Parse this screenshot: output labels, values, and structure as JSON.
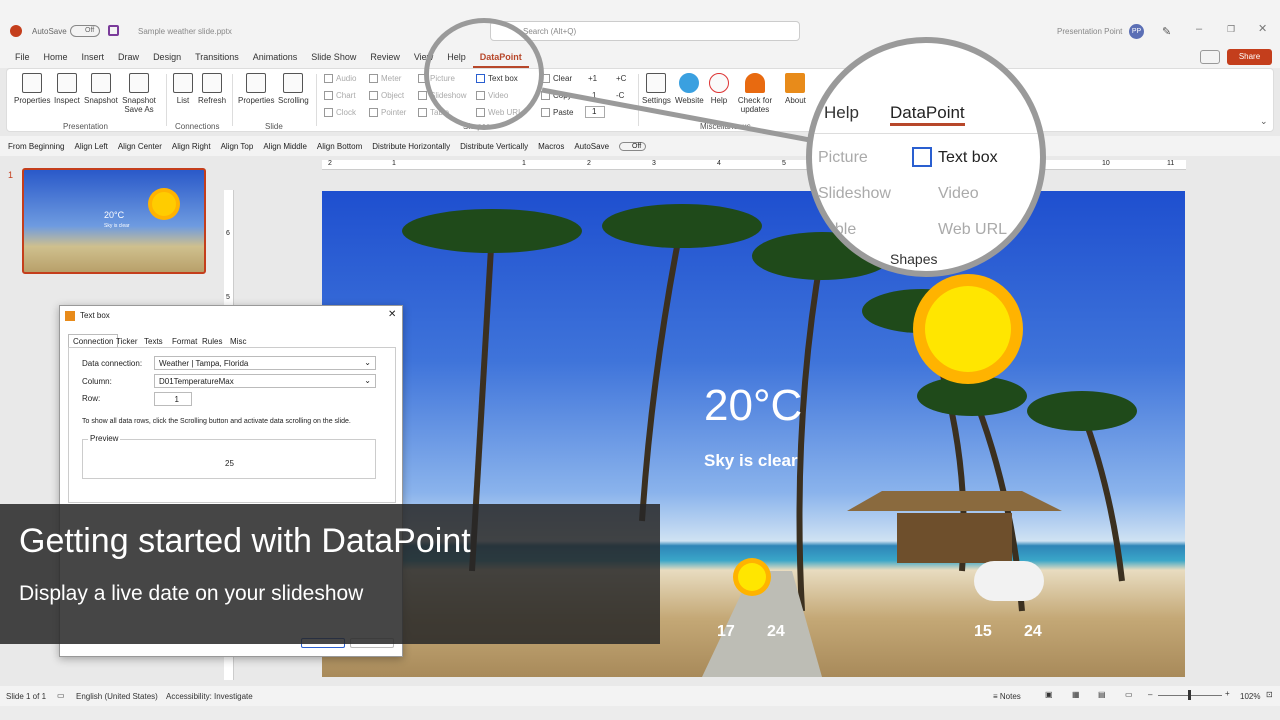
{
  "titlebar": {
    "autosave_label": "AutoSave",
    "autosave_state": "Off",
    "filename": "Sample weather slide.pptx",
    "search_placeholder": "Search (Alt+Q)",
    "user_name": "Presentation Point",
    "user_initials": "PP"
  },
  "menu_tabs": [
    "File",
    "Home",
    "Insert",
    "Draw",
    "Design",
    "Transitions",
    "Animations",
    "Slide Show",
    "Review",
    "View",
    "Help",
    "DataPoint"
  ],
  "active_tab": "DataPoint",
  "share_label": "Share",
  "ribbon": {
    "presentation": {
      "buttons": [
        "Properties",
        "Inspect",
        "Snapshot",
        "Snapshot Save As"
      ],
      "group": "Presentation"
    },
    "connections": {
      "buttons": [
        "List",
        "Refresh"
      ],
      "group": "Connections"
    },
    "slide": {
      "buttons": [
        "Properties",
        "Scrolling"
      ],
      "group": "Slide"
    },
    "shapes_col1": [
      "Audio",
      "Chart",
      "Clock"
    ],
    "shapes_col2": [
      "Meter",
      "Object",
      "Pointer"
    ],
    "shapes_col3": [
      "Picture",
      "Slideshow",
      "Table"
    ],
    "shapes_col4": [
      "Text box",
      "Video",
      "Web URL"
    ],
    "shapes_group": "Shapes",
    "clipboard": [
      "Clear",
      "Copy",
      "Paste"
    ],
    "counter": [
      "+1",
      "-1",
      "+C",
      "-C"
    ],
    "counter_value": "1",
    "misc": {
      "buttons": [
        "Settings",
        "Website",
        "Help",
        "Check for updates"
      ],
      "group": "Miscellaneous"
    },
    "about": "About"
  },
  "quick_toolbar": [
    "From Beginning",
    "Align Left",
    "Align Center",
    "Align Right",
    "Align Top",
    "Align Middle",
    "Align Bottom",
    "Distribute Horizontally",
    "Distribute Vertically",
    "Macros"
  ],
  "qt_autosave": "AutoSave",
  "qt_autosave_state": "Off",
  "slide_number": "1",
  "ruler_marks": [
    "2",
    "1",
    "1",
    "2",
    "3",
    "4",
    "5",
    "6",
    "7",
    "8",
    "9",
    "10",
    "11"
  ],
  "ruler_left_marks": [
    "6",
    "5"
  ],
  "magnifier": {
    "tabs": [
      "Help",
      "DataPoint"
    ],
    "col1": [
      "Picture",
      "Slideshow",
      "Table"
    ],
    "col2": [
      "Text box",
      "Video",
      "Web URL"
    ],
    "group": "Shapes"
  },
  "slide": {
    "temperature": "20°C",
    "condition": "Sky is clear",
    "day1_low": "17",
    "day1_high": "24",
    "day2_low": "15",
    "day2_high": "24"
  },
  "dialog": {
    "title": "Text box",
    "tabs": [
      "Connection",
      "Ticker",
      "Texts",
      "Format",
      "Rules",
      "Misc"
    ],
    "data_connection_label": "Data connection:",
    "data_connection_value": "Weather | Tampa, Florida",
    "column_label": "Column:",
    "column_value": "D01TemperatureMax",
    "row_label": "Row:",
    "row_value": "1",
    "hint": "To show all data rows, click the Scrolling button and activate data scrolling on the slide.",
    "preview_label": "Preview",
    "preview_value": "25"
  },
  "overlay": {
    "title": "Getting started with DataPoint",
    "subtitle": "Display a live date on your slideshow"
  },
  "statusbar": {
    "slide_info": "Slide 1 of 1",
    "language": "English (United States)",
    "accessibility": "Accessibility: Investigate",
    "notes": "Notes",
    "zoom": "102%"
  },
  "colors": {
    "accent": "#b7472a",
    "share": "#c43e1c",
    "sun": "#ffb300",
    "sky": "#2a5fd0"
  }
}
